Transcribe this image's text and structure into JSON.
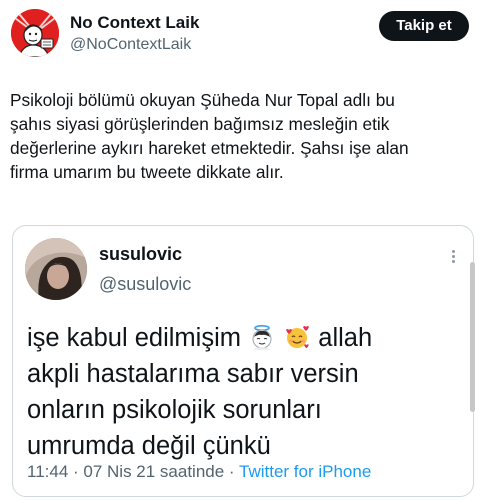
{
  "author": {
    "display_name": "No Context Laik",
    "handle": "@NoContextLaik",
    "avatar_icon": "caricature-avatar-icon"
  },
  "follow_button": {
    "label": "Takip et"
  },
  "tweet": {
    "lines": [
      "Psikoloji bölümü okuyan Şüheda Nur Topal adlı bu",
      "şahıs siyasi görüşlerinden bağımsız mesleğin etik",
      "değerlerine aykırı hareket etmektedir. Şahsı işe alan",
      "firma umarım bu tweete dikkate alır."
    ]
  },
  "quoted": {
    "display_name": "susulovic",
    "handle": "@susulovic",
    "avatar_icon": "profile-photo-avatar",
    "more_icon": "vertical-ellipsis-icon",
    "text": {
      "line1_before": "işe kabul edilmişim",
      "line1_after": "allah",
      "line2": "akpli hastalarıma sabır versin",
      "line3": "onların psikolojik sorunları",
      "line4": "umrumda değil çünkü"
    },
    "emojis": [
      "angel-face-emoji",
      "smiling-face-with-hearts-emoji"
    ],
    "meta": {
      "timestamp": "11:44 · 07 Nis 21 saatinde ·",
      "source": "Twitter for iPhone"
    }
  },
  "colors": {
    "text_primary": "#0f1419",
    "text_secondary": "#536471",
    "link": "#1d9bf0",
    "follow_bg": "#0f1419",
    "avatar_red": "#e0201f",
    "border": "#cfd9de"
  }
}
